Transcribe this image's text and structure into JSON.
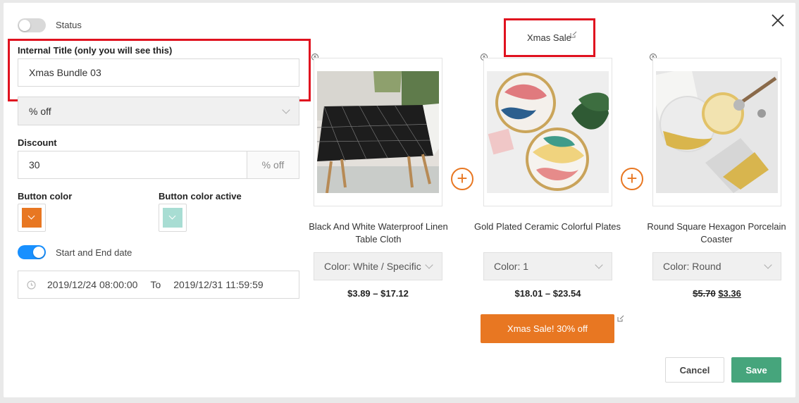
{
  "status": {
    "label": "Status",
    "enabled": false
  },
  "internal_title": {
    "label": "Internal Title (only you will see this)",
    "value": "Xmas Bundle 03"
  },
  "discount_type": {
    "value": "% off"
  },
  "discount": {
    "label": "Discount",
    "value": "30",
    "suffix": "% off"
  },
  "button_color": {
    "label": "Button color",
    "color": "#e87722"
  },
  "button_color_active": {
    "label": "Button color active",
    "color": "#a8ddd3"
  },
  "date_range": {
    "label": "Start and End date",
    "enabled": true,
    "start": "2019/12/24 08:00:00",
    "separator": "To",
    "end": "2019/12/31 11:59:59"
  },
  "bundle": {
    "title": "Xmas Sale",
    "cta_label": "Xmas Sale! 30% off"
  },
  "products": [
    {
      "name": "Black And White Waterproof Linen Table Cloth",
      "variant": "Color: White / Specific",
      "price": "$3.89 – $17.12"
    },
    {
      "name": "Gold Plated Ceramic Colorful Plates",
      "variant": "Color: 1",
      "price": "$18.01 – $23.54"
    },
    {
      "name": "Round Square Hexagon Porcelain Coaster",
      "variant": "Color: Round",
      "price_old": "$5.70",
      "price_new": "$3.36"
    }
  ],
  "actions": {
    "cancel": "Cancel",
    "save": "Save"
  },
  "colors": {
    "accent": "#e87722",
    "save": "#46a57c",
    "toggle_on": "#1890ff",
    "highlight": "#e0121f"
  }
}
